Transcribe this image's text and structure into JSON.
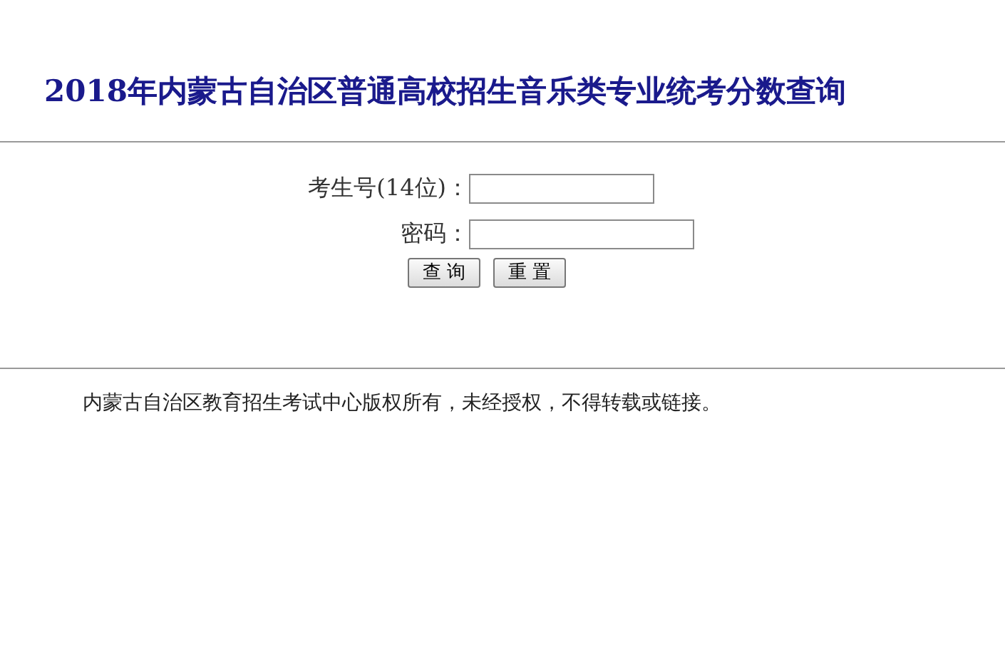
{
  "title": "2018年内蒙古自治区普通高校招生音乐类专业统考分数查询",
  "fields": [
    {
      "label": "考生号(14位)："
    },
    {
      "label": "密码："
    }
  ],
  "buttons": [
    "查 询",
    "重 置"
  ],
  "footer": "内蒙古自治区教育招生考试中心版权所有，未经授权，不得转载或链接。"
}
